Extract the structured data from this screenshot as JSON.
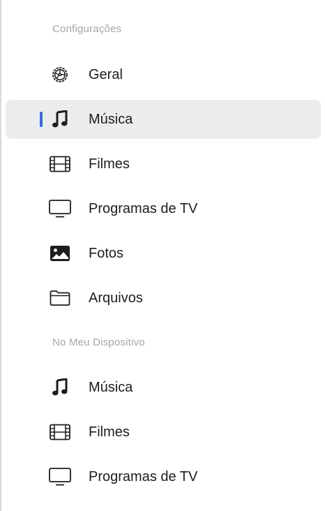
{
  "sidebar": {
    "sections": [
      {
        "header": "Configurações",
        "items": [
          {
            "label": "Geral",
            "icon": "gear-icon"
          },
          {
            "label": "Música",
            "icon": "music-note-icon",
            "selected": true
          },
          {
            "label": "Filmes",
            "icon": "film-icon"
          },
          {
            "label": "Programas de TV",
            "icon": "tv-icon"
          },
          {
            "label": "Fotos",
            "icon": "photo-icon"
          },
          {
            "label": "Arquivos",
            "icon": "folder-icon"
          }
        ]
      },
      {
        "header": "No Meu Dispositivo",
        "items": [
          {
            "label": "Música",
            "icon": "music-note-icon"
          },
          {
            "label": "Filmes",
            "icon": "film-icon"
          },
          {
            "label": "Programas de TV",
            "icon": "tv-icon"
          }
        ]
      }
    ]
  },
  "colors": {
    "selection_indicator": "#2f6fde",
    "selection_background": "#ececec",
    "section_header": "#a6a6a6",
    "text": "#1d1d1f"
  }
}
